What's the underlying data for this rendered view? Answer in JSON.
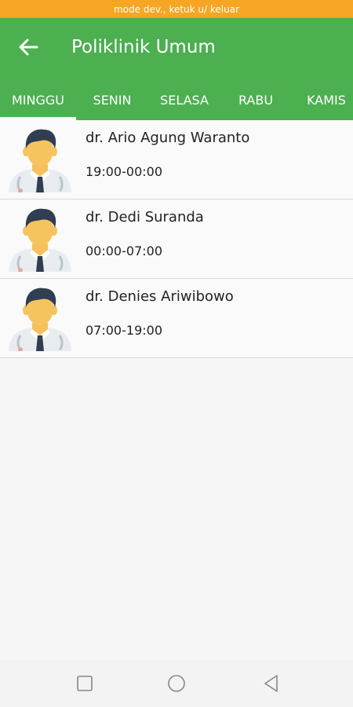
{
  "dev_banner": "mode dev., ketuk u/ keluar",
  "header": {
    "title": "Poliklinik Umum",
    "back_icon": "arrow-left-icon"
  },
  "tabs": [
    {
      "label": "MINGGU",
      "selected": true
    },
    {
      "label": "SENIN",
      "selected": false
    },
    {
      "label": "SELASA",
      "selected": false
    },
    {
      "label": "RABU",
      "selected": false
    },
    {
      "label": "KAMIS",
      "selected": false
    }
  ],
  "doctors": [
    {
      "name": "dr. Ario Agung Waranto",
      "time": "19:00-00:00",
      "avatar_icon": "doctor-avatar-icon"
    },
    {
      "name": "dr. Dedi Suranda",
      "time": "00:00-07:00",
      "avatar_icon": "doctor-avatar-icon"
    },
    {
      "name": "dr. Denies Ariwibowo",
      "time": "07:00-19:00",
      "avatar_icon": "doctor-avatar-icon"
    }
  ],
  "nav": {
    "recent_icon": "square-icon",
    "home_icon": "circle-icon",
    "back_icon": "triangle-back-icon"
  },
  "colors": {
    "appbar": "#4caf50",
    "dev_banner": "#f6a623",
    "tab_indicator": "#ffffff"
  }
}
